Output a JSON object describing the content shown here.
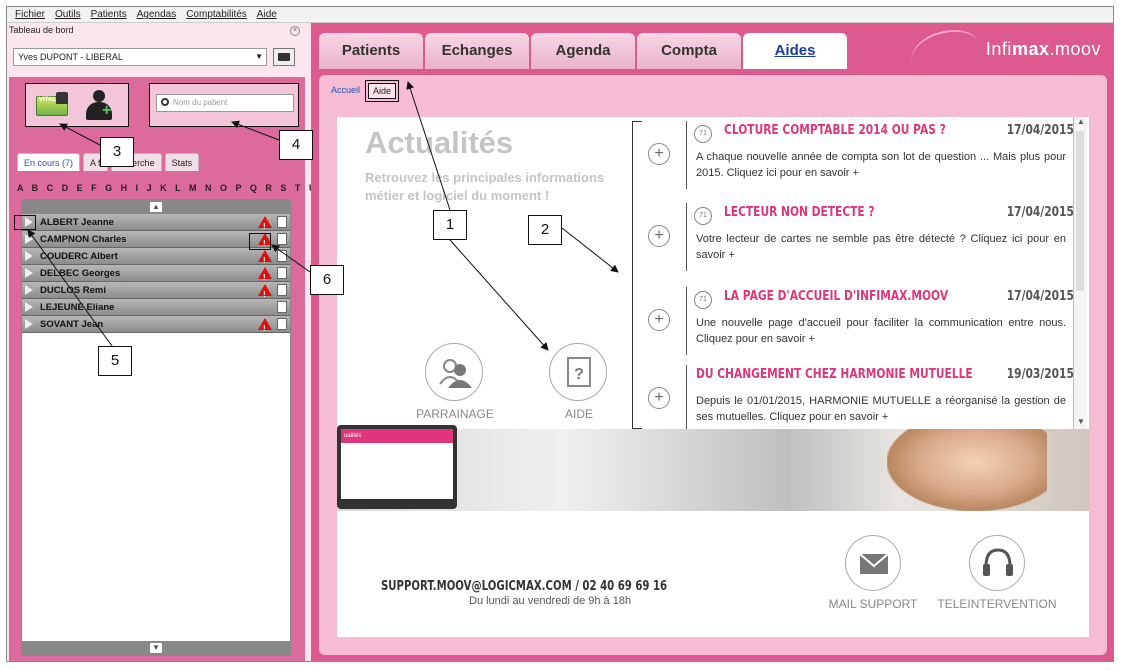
{
  "menubar": [
    "Fichier",
    "Outils",
    "Patients",
    "Agendas",
    "Comptabilités",
    "Aide"
  ],
  "left_panel": {
    "title": "Tableau de bord",
    "user_select": "Yves DUPONT - LIBERAL",
    "search_placeholder": "Nom du patient",
    "tabs": [
      "En cours (7)",
      "A f",
      "echerche",
      "Stats"
    ],
    "alphabet": "A B C D E F G H I J K L M N O P Q R S T U V W X Y Z",
    "patients": [
      {
        "name": "ALBERT Jeanne",
        "warning": true
      },
      {
        "name": "CAMPNON Charles",
        "warning": true
      },
      {
        "name": "COUDERC Albert",
        "warning": true
      },
      {
        "name": "DELBEC Georges",
        "warning": true
      },
      {
        "name": "DUCLOS Remi",
        "warning": true
      },
      {
        "name": "LEJEUNE Eliane",
        "warning": false
      },
      {
        "name": "SOVANT Jean",
        "warning": true
      }
    ]
  },
  "topnav": {
    "tabs": [
      "Patients",
      "Echanges",
      "Agenda",
      "Compta",
      "Aides"
    ],
    "active": "Aides"
  },
  "logo": {
    "part1": "Infi",
    "part2": "max",
    "part3": ".moov"
  },
  "subtabs": [
    "Accueil",
    "Aide"
  ],
  "actualites": {
    "title": "Actualités",
    "subtitle": "Retrouvez les principales informations métier et logiciel du moment !",
    "parrainage": "PARRAINAGE",
    "aide": "AIDE"
  },
  "news": [
    {
      "title": "CLOTURE COMPTABLE 2014 OU PAS ?",
      "date": "17/04/2015",
      "text": "A chaque nouvelle année de compta son lot de question ... Mais plus pour 2015. Cliquez ici pour en savoir +"
    },
    {
      "title": "LECTEUR NON DETECTE ?",
      "date": "17/04/2015",
      "text": "Votre lecteur de cartes ne semble pas être détecté ? Cliquez ici pour en savoir +"
    },
    {
      "title": "LA PAGE D'ACCUEIL D'INFIMAX.MOOV",
      "date": "17/04/2015",
      "text": " Une nouvelle page d'accueil pour faciliter la communication entre nous. Cliquez pour en savoir +"
    },
    {
      "title": "DU CHANGEMENT CHEZ HARMONIE MUTUELLE",
      "date": "19/03/2015",
      "text": "Depuis le 01/01/2015, HARMONIE MUTUELLE a réorganisé la gestion de ses mutuelles. Cliquez pour en savoir +"
    }
  ],
  "banner_laptop_text": "ualités",
  "support": {
    "line": "SUPPORT.MOOV@LOGICMAX.COM / 02 40 69 69 16",
    "hours": "Du lundi au vendredi de 9h à 18h",
    "mail": "MAIL SUPPORT",
    "tele": "TELEINTERVENTION"
  },
  "callouts": [
    "1",
    "2",
    "3",
    "4",
    "5",
    "6"
  ]
}
